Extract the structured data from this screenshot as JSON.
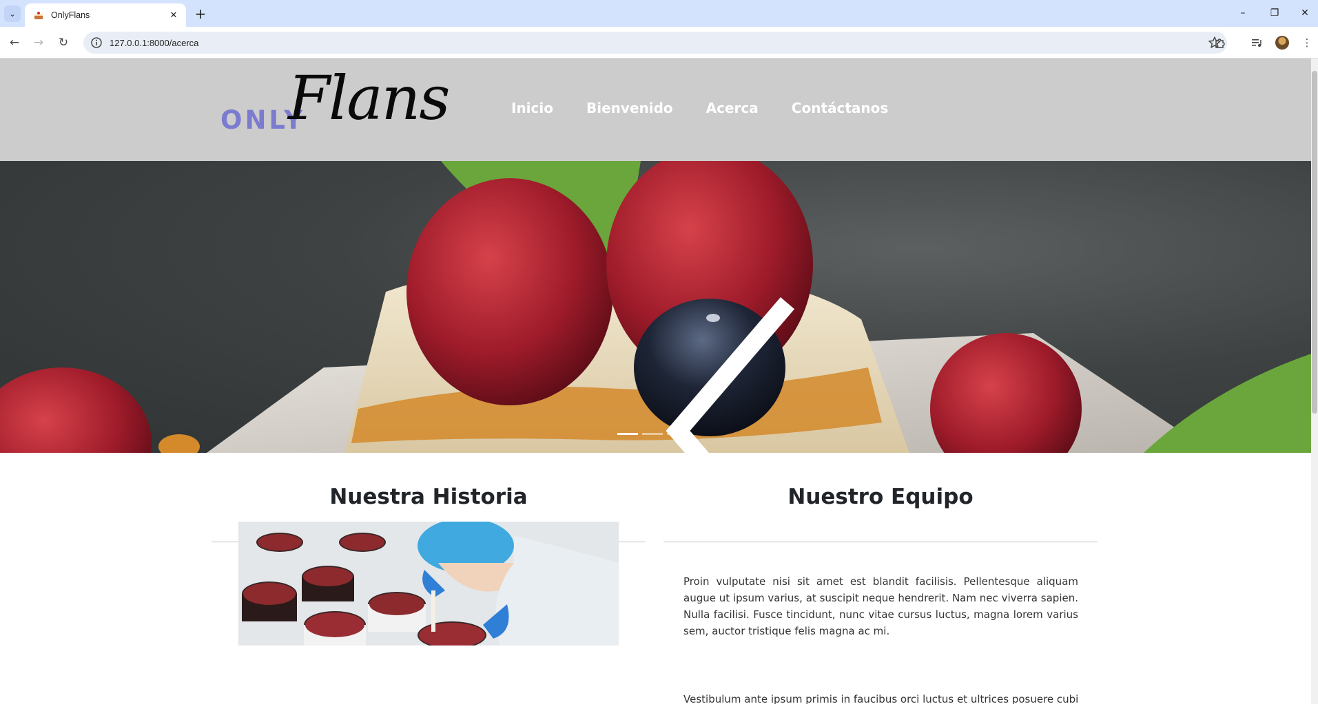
{
  "browser": {
    "tab_title": "OnlyFlans",
    "url": "127.0.0.1:8000/acerca",
    "icons": {
      "tab_search": "chevron-down-icon",
      "close_tab": "close-icon",
      "new_tab": "plus-icon",
      "minimize": "minimize-icon",
      "restore": "restore-icon",
      "close_window": "close-icon",
      "back": "arrow-left-icon",
      "forward": "arrow-right-icon",
      "reload": "reload-icon",
      "site_info": "info-icon",
      "bookmark": "star-icon",
      "extensions": "puzzle-icon",
      "media": "media-icon",
      "menu": "kebab-icon"
    },
    "colors": {
      "tabbar": "#d3e3fd",
      "omnibox": "#e9eef6"
    }
  },
  "site": {
    "logo_only": "ONLY",
    "logo_flans": "Flans",
    "nav": [
      {
        "label": "Inicio"
      },
      {
        "label": "Bienvenido"
      },
      {
        "label": "Acerca"
      },
      {
        "label": "Contáctanos"
      }
    ],
    "colors": {
      "header_bg": "#cccccc",
      "logo_accent": "#7b7bd0",
      "nav_text": "#ffffff"
    }
  },
  "carousel": {
    "slide_count": 3,
    "active_slide": 1,
    "prev_icon": "chevron-left-icon",
    "next_icon": "chevron-right-icon"
  },
  "historia": {
    "title": "Nuestra Historia"
  },
  "equipo": {
    "title": "Nuestro Equipo",
    "paragraphs": [
      "Proin vulputate nisi sit amet est blandit facilisis. Pellentesque aliquam augue ut ipsum varius, at suscipit neque hendrerit. Nam nec viverra sapien. Nulla facilisi. Fusce tincidunt, nunc vitae cursus luctus, magna lorem varius sem, auctor tristique felis magna ac mi.",
      "Vestibulum ante ipsum primis in faucibus orci luctus et ultrices posuere cubilia"
    ]
  }
}
